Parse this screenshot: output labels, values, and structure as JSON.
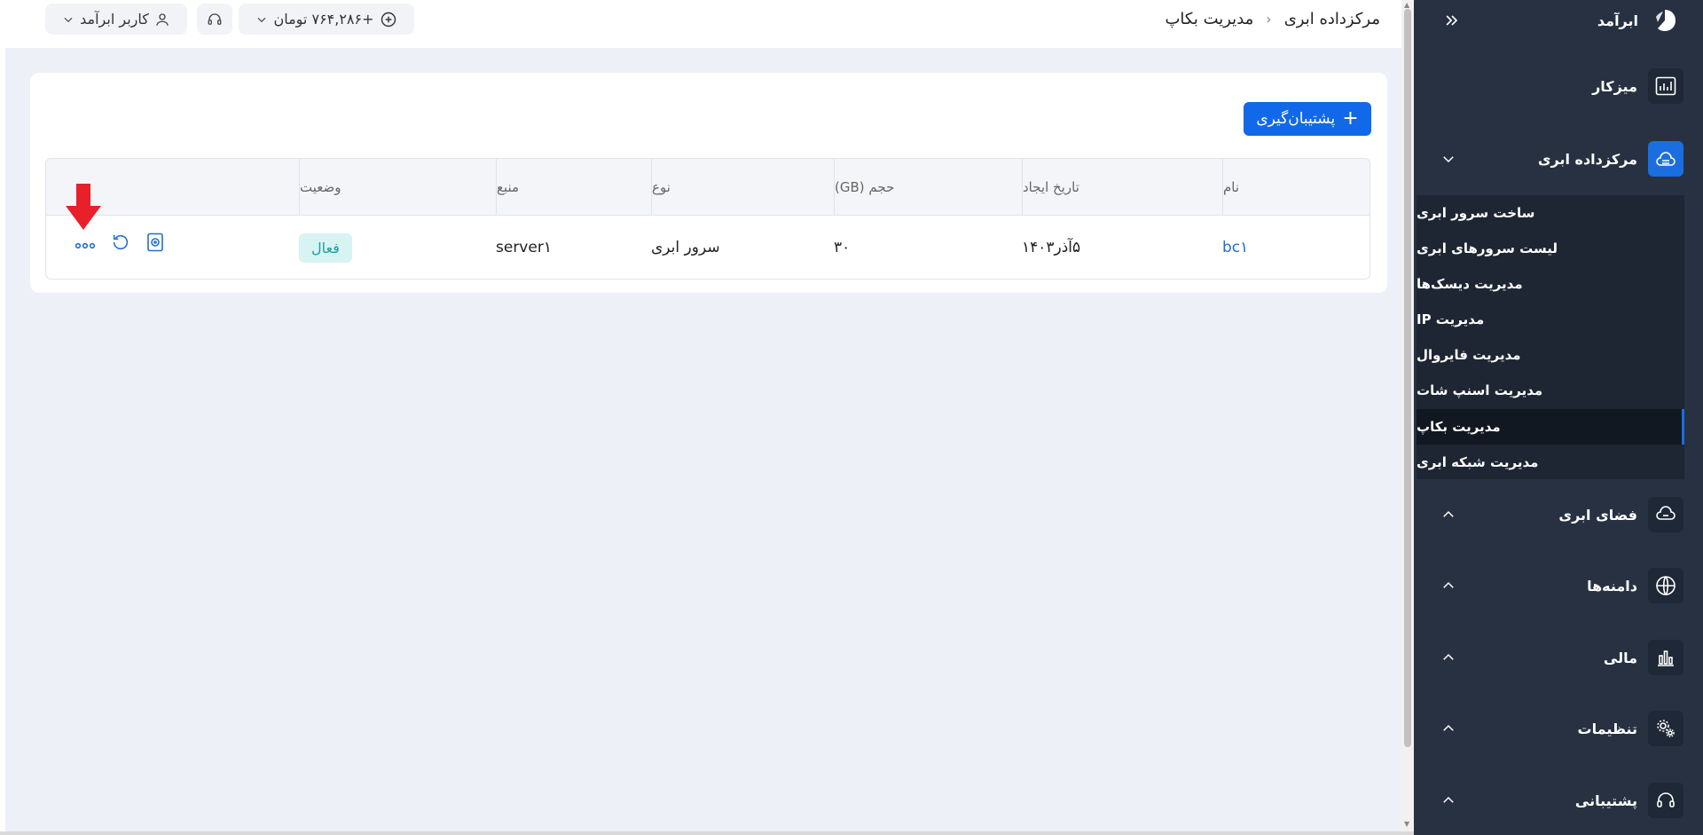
{
  "topbar": {
    "user_label": "کاربر ابرآمد",
    "balance_label": "+۷۶۴,۲۸۶ تومان"
  },
  "breadcrumb": {
    "parent": "مرکزداده ابری",
    "current": "مدیریت بکاپ"
  },
  "toolbar": {
    "add_backup_label": "پشتیبان‌گیری"
  },
  "table": {
    "columns": [
      "نام",
      "تاریخ ایجاد",
      "حجم (GB)",
      "نوع",
      "منبع",
      "وضعیت"
    ],
    "rows": [
      {
        "name": "bc۱",
        "created": "۵آذر۱۴۰۳",
        "size": "۳۰",
        "type": "سرور ابری",
        "source": "server۱",
        "status": "فعال"
      }
    ]
  },
  "colors": {
    "accent": "#1168e8",
    "sidebar_bg": "#273142",
    "status_bg": "#d7f3f2",
    "status_text": "#1aa3a0",
    "annotation_arrow": "#e8202a"
  },
  "sidebar": {
    "brand": "ابرآمد",
    "items": [
      {
        "label": "میزکار",
        "icon": "dashboard-chart-icon"
      },
      {
        "label": "مرکزداده ابری",
        "icon": "cloud-datacenter-icon"
      },
      {
        "label": "فضای ابری",
        "icon": "cloud-storage-icon"
      },
      {
        "label": "دامنه‌ها",
        "icon": "globe-icon"
      },
      {
        "label": "مالی",
        "icon": "finance-chart-icon"
      },
      {
        "label": "تنظیمات",
        "icon": "settings-gears-icon"
      },
      {
        "label": "پشتیبانی",
        "icon": "headset-icon"
      }
    ],
    "submenu": [
      {
        "label": "ساخت سرور ابری"
      },
      {
        "label": "لیست سرورهای ابری"
      },
      {
        "label": "مدیریت دیسک‌ها"
      },
      {
        "label": "مدیریت IP"
      },
      {
        "label": "مدیریت فایروال"
      },
      {
        "label": "مدیریت اسنپ شات"
      },
      {
        "label": "مدیریت بکاپ"
      },
      {
        "label": "مدیریت شبکه ابری"
      }
    ]
  }
}
